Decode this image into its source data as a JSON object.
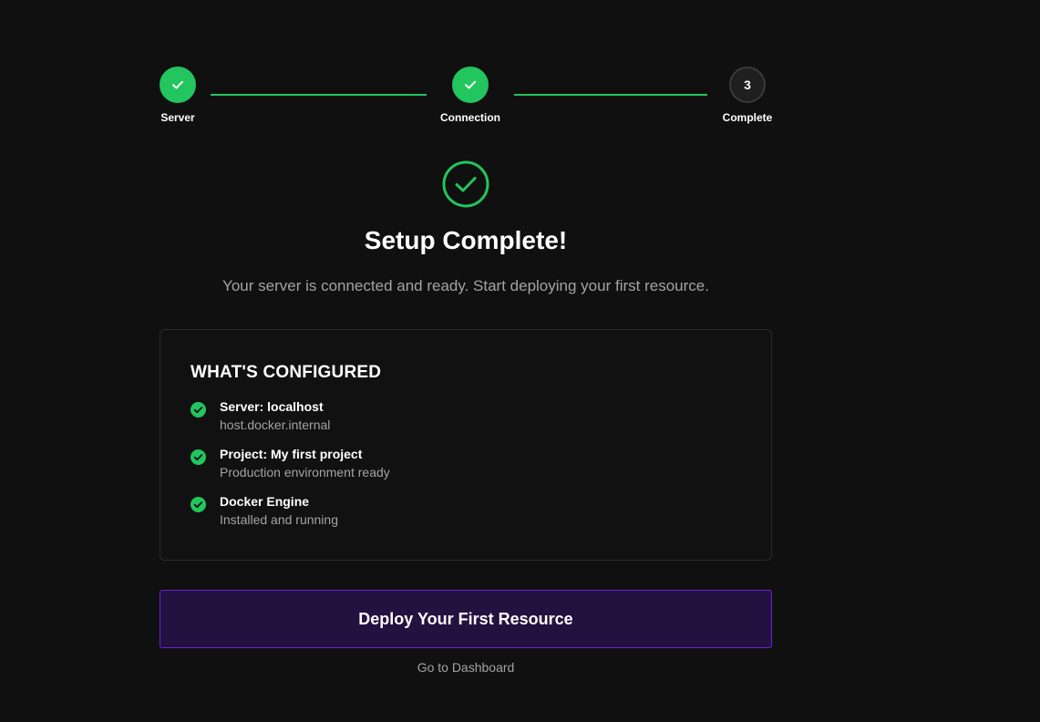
{
  "stepper": {
    "steps": [
      {
        "label": "Server",
        "status": "complete"
      },
      {
        "label": "Connection",
        "status": "complete"
      },
      {
        "label": "Complete",
        "number": "3",
        "status": "current"
      }
    ]
  },
  "hero": {
    "title": "Setup Complete!",
    "subtitle": "Your server is connected and ready. Start deploying your first resource."
  },
  "configured": {
    "title": "WHAT'S CONFIGURED",
    "items": [
      {
        "title": "Server: localhost",
        "subtitle": "host.docker.internal",
        "icon": "check-circle-icon"
      },
      {
        "title": "Project: My first project",
        "subtitle": "Production environment ready",
        "icon": "check-circle-icon"
      },
      {
        "title": "Docker Engine",
        "subtitle": "Installed and running",
        "icon": "check-circle-icon"
      }
    ]
  },
  "actions": {
    "primary_label": "Deploy Your First Resource",
    "secondary_label": "Go to Dashboard"
  },
  "colors": {
    "success": "#22c55e",
    "accent_border": "#6b21d8",
    "accent_bg": "#23113f",
    "background": "#101010"
  }
}
